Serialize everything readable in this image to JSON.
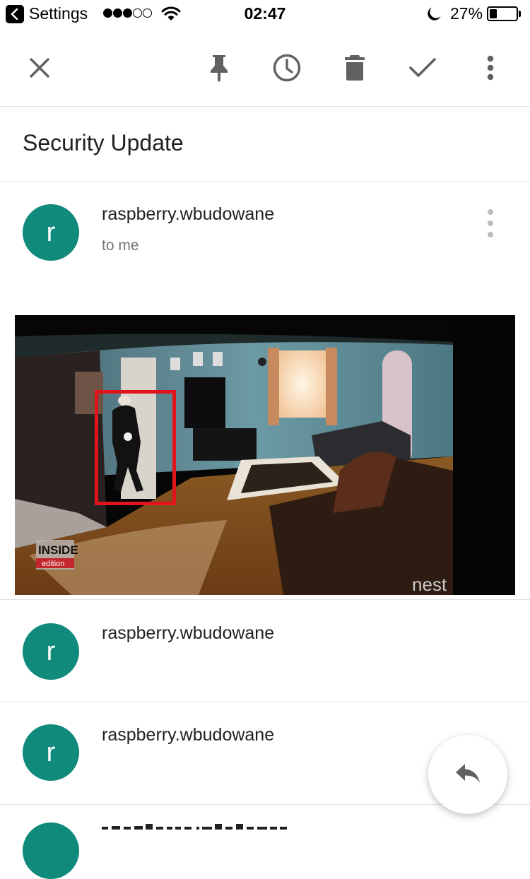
{
  "status_bar": {
    "back_app": "Settings",
    "signal_bars": 3,
    "signal_total": 5,
    "time": "02:47",
    "battery_percent": "27%",
    "battery_level": 0.27,
    "icons": [
      "back-arrow-icon",
      "wifi-icon",
      "moon-icon",
      "battery-icon"
    ]
  },
  "toolbar": {
    "icons": [
      "close-icon",
      "pin-icon",
      "clock-icon",
      "trash-icon",
      "check-icon",
      "more-vert-icon"
    ]
  },
  "subject": "Security Update",
  "messages": [
    {
      "sender": "raspberry.wbudowane",
      "avatar_letter": "r",
      "recipient": "to me",
      "expanded": true
    },
    {
      "sender": "raspberry.wbudowane",
      "avatar_letter": "r"
    },
    {
      "sender": "raspberry.wbudowane",
      "avatar_letter": "r"
    }
  ],
  "attachment": {
    "kind": "security-camera-snapshot",
    "watermark_left_top": "INSIDE",
    "watermark_left_bottom": "edition",
    "watermark_right": "nest"
  },
  "fab": {
    "icon": "reply-icon"
  },
  "colors": {
    "avatar": "#0f8a7b",
    "icon_gray": "#616161",
    "divider": "#e2e2e2",
    "detection_box": "#e0141a"
  }
}
